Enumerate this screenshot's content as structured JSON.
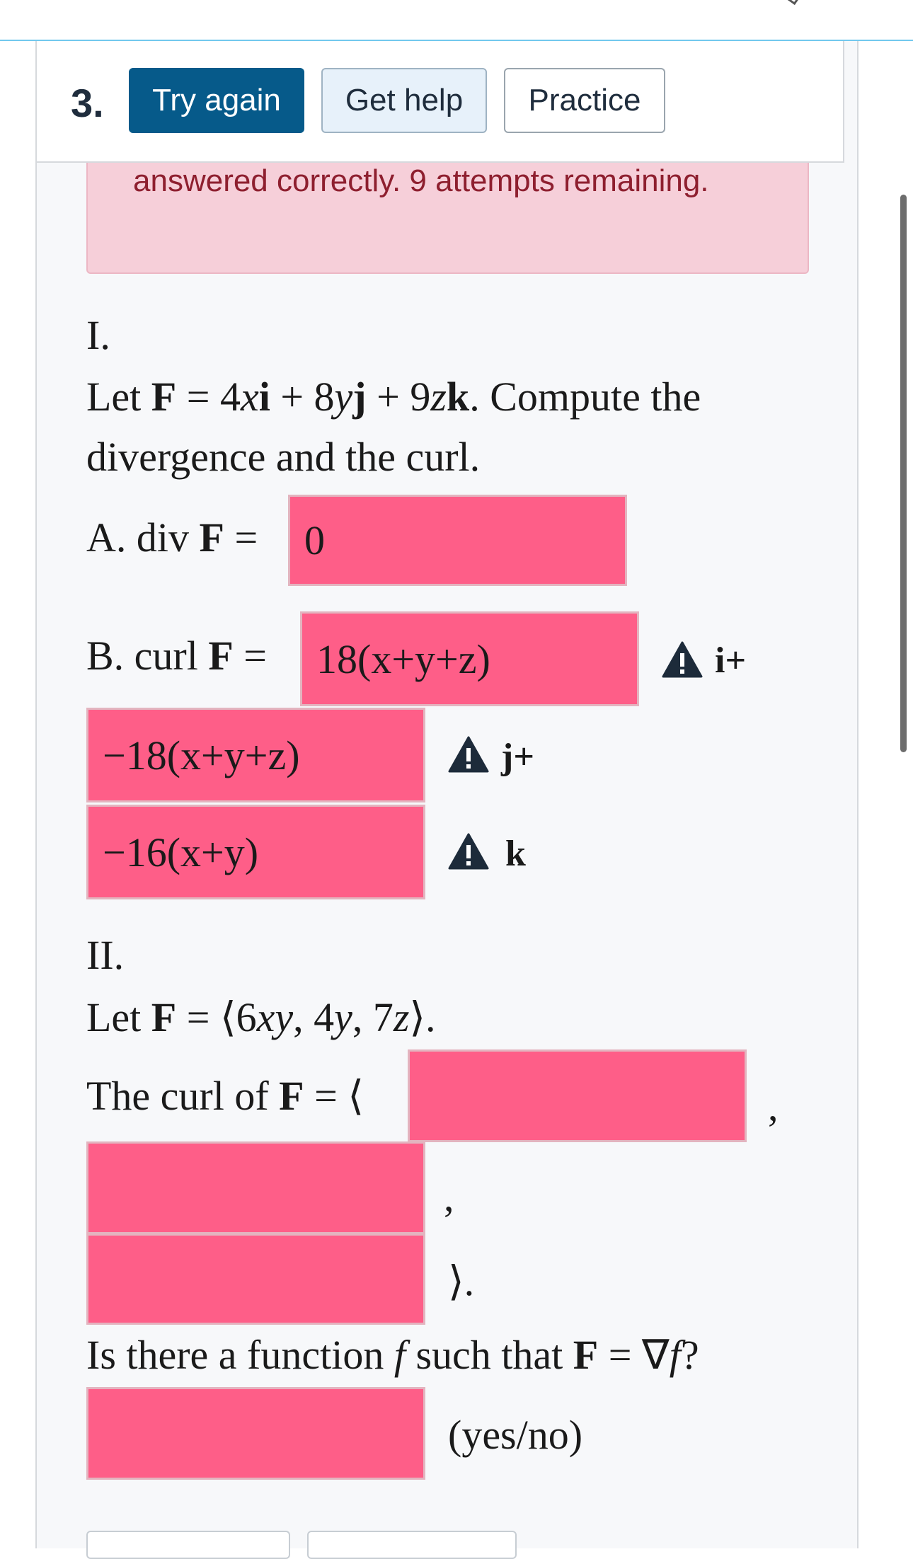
{
  "header": {
    "question_number": "3.",
    "buttons": {
      "try_again": "Try again",
      "get_help": "Get help",
      "practice": "Practice"
    }
  },
  "alert": {
    "text": "answered correctly. 9 attempts remaining."
  },
  "part1": {
    "label": "I.",
    "prompt_suffix_1": ". Compute the",
    "prompt_line2": "divergence and the curl.",
    "div_label": "A. div",
    "div_value": "0",
    "curl_label": "B. curl",
    "curl_i": "18(x+y+z)",
    "curl_j": "−18(x+y+z)",
    "curl_k": "−16(x+y)",
    "unit_i": "i+",
    "unit_j": "j+",
    "unit_k": "k"
  },
  "part2": {
    "label": "II.",
    "let": "Let",
    "curl_of": "The curl of",
    "comma": ",",
    "close": "⟩.",
    "question_text_1": "Is there a function",
    "question_text_2": "such that",
    "yes_no": "(yes/no)"
  },
  "colors": {
    "accent": "#065a8a",
    "field_error": "#fe5e88",
    "alert_bg": "#f6cfd9",
    "alert_text": "#8e1f2f"
  },
  "icons": [
    "warning-icon",
    "checkmark-icon"
  ]
}
